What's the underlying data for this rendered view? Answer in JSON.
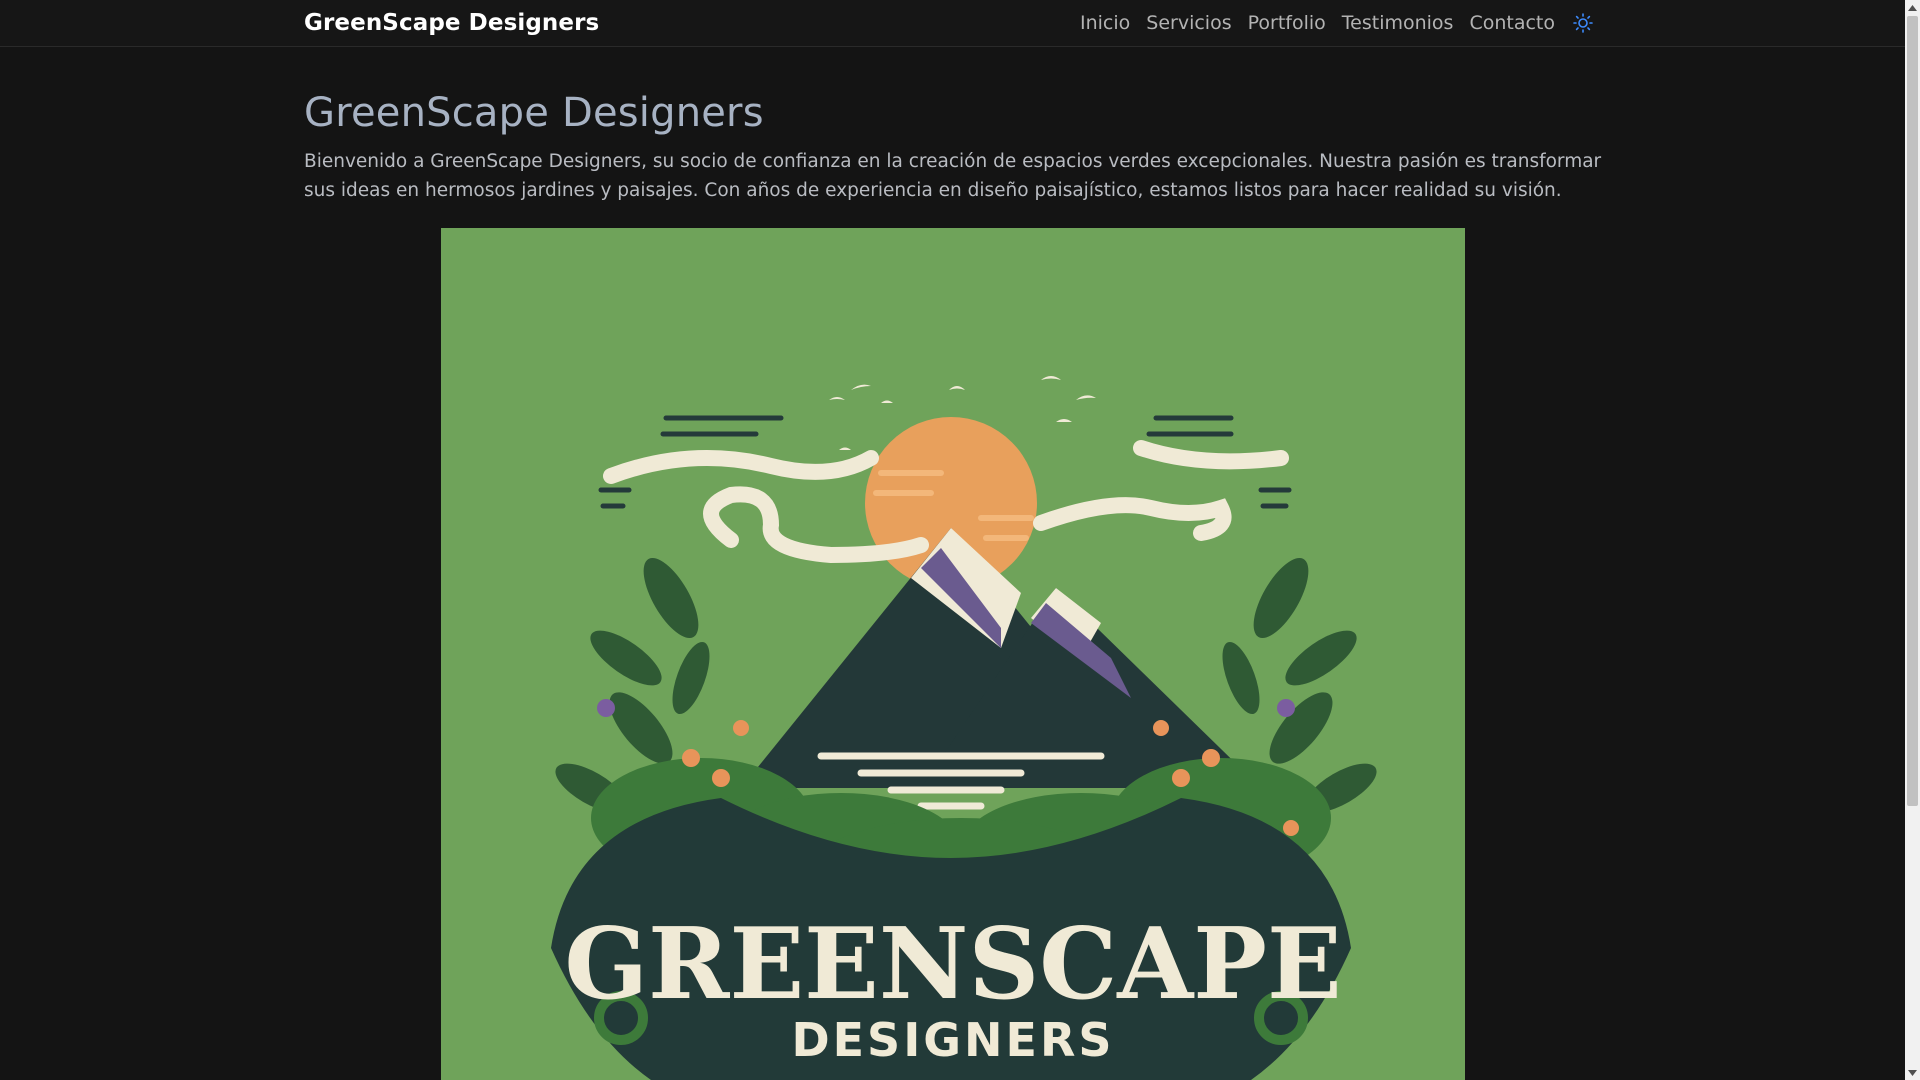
{
  "nav": {
    "brand": "GreenScape Designers",
    "links": [
      "Inicio",
      "Servicios",
      "Portfolio",
      "Testimonios",
      "Contacto"
    ],
    "theme_toggle_icon": "sun-icon",
    "accent": "#3d8bfd"
  },
  "hero": {
    "title": "GreenScape Designers",
    "text": "Bienvenido a GreenScape Designers, su socio de confianza en la creación de espacios verdes excepcionales. Nuestra pasión es transformar sus ideas en hermosos jardines y paisajes. Con años de experiencia en diseño paisajístico, estamos listos para hacer realidad su visión.",
    "image": {
      "logo_line1": "GREENSCAPE",
      "logo_line2": "DESIGNERS",
      "background": "#6fa35a"
    }
  }
}
